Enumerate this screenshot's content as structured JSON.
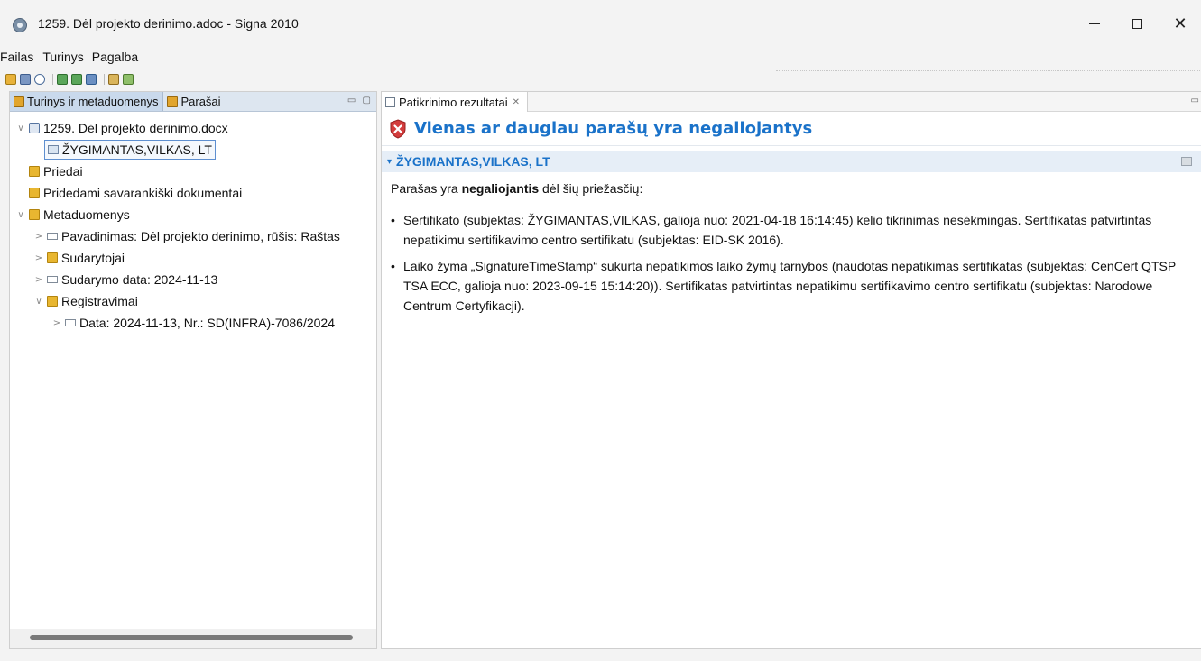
{
  "window": {
    "title": "1259. Dėl projekto derinimo.adoc - Signa 2010",
    "minimize": "—",
    "maximize": "☐",
    "close": "✕"
  },
  "menu": [
    "Failas",
    "Turinys",
    "Pagalba"
  ],
  "toolbar": {
    "icons": [
      "open-icon",
      "save-icon",
      "at-icon",
      "add-signature-icon",
      "add-doc-icon",
      "add-attachment-icon",
      "sign-icon",
      "verify-icon"
    ]
  },
  "left_view": {
    "tabs": [
      {
        "label": "Turinys ir metaduomenys",
        "active": true
      },
      {
        "label": "Parašai",
        "active": false
      }
    ],
    "controls": "▭ ▢",
    "tree": [
      {
        "indent": 0,
        "twisty": "∨",
        "icon": "doc",
        "label": "1259. Dėl projekto derinimo.docx"
      },
      {
        "indent": 1,
        "twisty": "",
        "icon": "sig",
        "label": "ŽYGIMANTAS,VILKAS, LT",
        "selected": true
      },
      {
        "indent": 0,
        "twisty": "",
        "icon": "folder",
        "label": "Priedai"
      },
      {
        "indent": 0,
        "twisty": "",
        "icon": "folder",
        "label": "Pridedami savarankiški dokumentai"
      },
      {
        "indent": 0,
        "twisty": "∨",
        "icon": "folder",
        "label": "Metaduomenys"
      },
      {
        "indent": 1,
        "twisty": ">",
        "icon": "leaf",
        "label": "Pavadinimas: Dėl projekto derinimo, rūšis: Raštas"
      },
      {
        "indent": 1,
        "twisty": ">",
        "icon": "folder",
        "label": "Sudarytojai"
      },
      {
        "indent": 1,
        "twisty": ">",
        "icon": "leaf",
        "label": "Sudarymo data: 2024-11-13"
      },
      {
        "indent": 1,
        "twisty": "∨",
        "icon": "folder",
        "label": "Registravimai"
      },
      {
        "indent": 2,
        "twisty": ">",
        "icon": "leaf",
        "label": "Data: 2024-11-13, Nr.: SD(INFRA)-7086/2024"
      }
    ]
  },
  "right_view": {
    "tab_label": "Patikrinimo rezultatai",
    "tab_close": "✕",
    "controls": "▭",
    "result_title": "Vienas ar daugiau parašų yra negaliojantys",
    "section_title": "ŽYGIMANTAS,VILKAS, LT",
    "intro_prefix": "Parašas yra ",
    "intro_bold": "negaliojantis",
    "intro_suffix": " dėl šių priežasčių:",
    "reasons": [
      "Sertifikato (subjektas: ŽYGIMANTAS,VILKAS, galioja nuo: 2021-04-18 16:14:45) kelio tikrinimas nesėkmingas. Sertifikatas patvirtintas nepatikimu sertifikavimo centro sertifikatu (subjektas: EID-SK 2016).",
      "Laiko žyma „SignatureTimeStamp“ sukurta nepatikimos laiko žymų tarnybos (naudotas nepatikimas sertifikatas (subjektas: CenCert QTSP TSA ECC, galioja nuo: 2023-09-15 15:14:20)). Sertifikatas patvirtintas nepatikimu sertifikavimo centro sertifikatu (subjektas: Narodowe Centrum Certyfikacji)."
    ]
  },
  "colors": {
    "accent": "#1a72c9",
    "error": "#d33c3c",
    "section_bg": "#e6eef7",
    "tab_active_bg": "#c9d9ec"
  }
}
